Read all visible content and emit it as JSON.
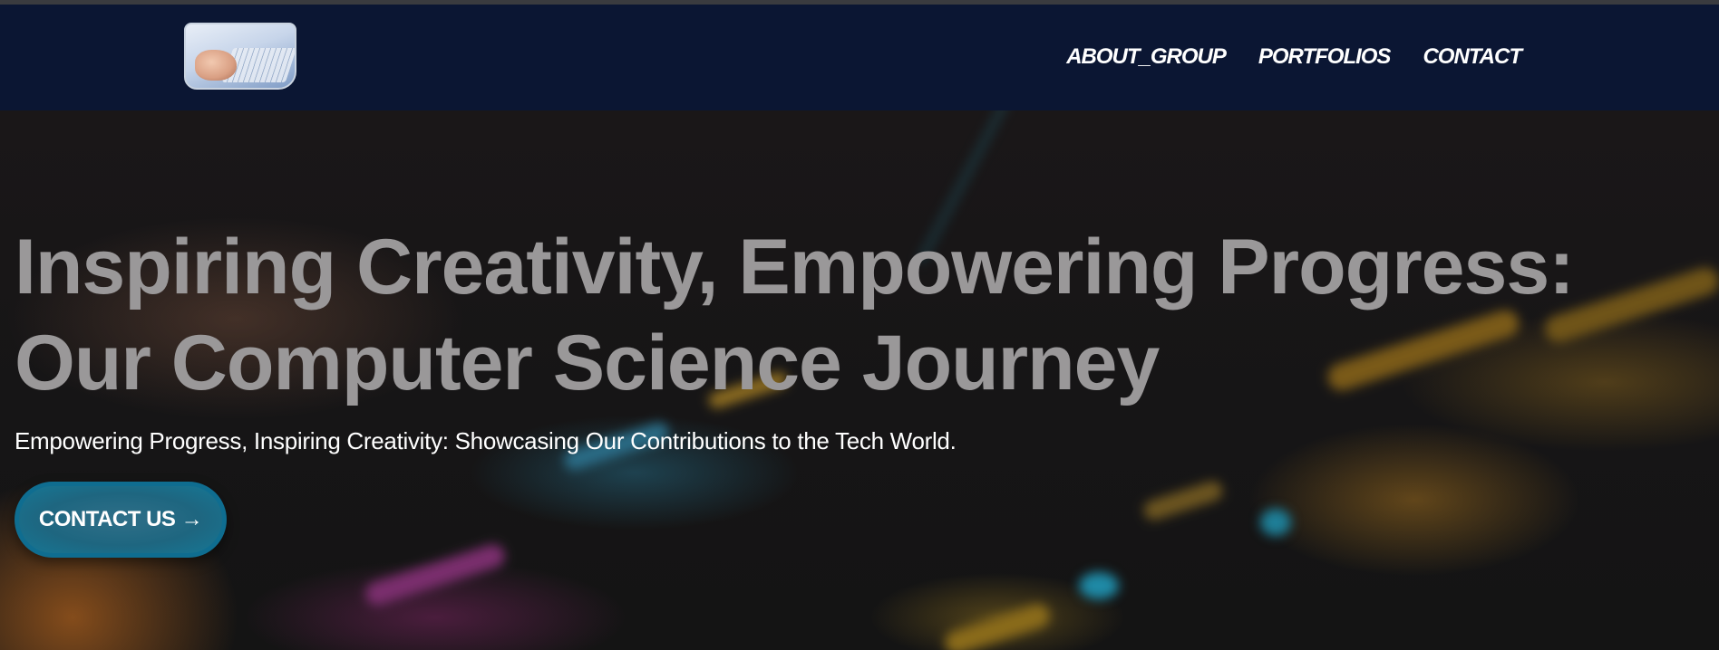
{
  "nav": {
    "logo_alt": "Computer science logo",
    "items": [
      {
        "label": "ABOUT_GROUP"
      },
      {
        "label": "PORTFOLIOS"
      },
      {
        "label": "CONTACT"
      }
    ]
  },
  "hero": {
    "title": "Inspiring Creativity, Empowering Progress: Our Computer Science Journey",
    "subtitle": "Empowering Progress, Inspiring Creativity: Showcasing Our Contributions to the Tech World.",
    "cta_label": "CONTACT US →"
  },
  "colors": {
    "navbar_bg": "#0b1633",
    "title_text": "#9a9899",
    "cta_bg": "#1e6680",
    "cta_border": "#0f6d90"
  }
}
